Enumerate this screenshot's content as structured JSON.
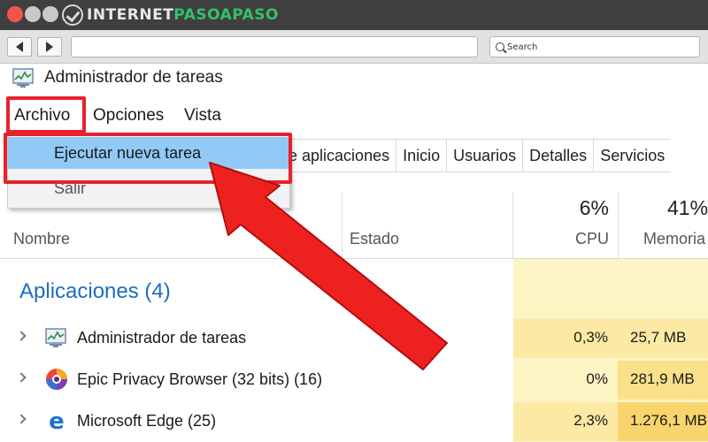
{
  "browser": {
    "brand_name": "INTERNETPASOAPASO",
    "brand_prefix": "INTERNET",
    "brand_accent": "PASOAPASO",
    "search_placeholder": "Search",
    "colors": {
      "titlebar": "#3f3f3f",
      "close_dot": "#f2554f",
      "accent": "#33c06a"
    }
  },
  "app": {
    "title": "Administrador de tareas",
    "icon": "task-manager-icon"
  },
  "menubar": {
    "archivo": "Archivo",
    "opciones": "Opciones",
    "vista": "Vista"
  },
  "file_menu": {
    "run_new_task": "Ejecutar nueva tarea",
    "exit": "Salir",
    "highlight_color": "#91c9f7"
  },
  "tabs": [
    {
      "label": "de aplicaciones"
    },
    {
      "label": "Inicio"
    },
    {
      "label": "Usuarios"
    },
    {
      "label": "Detalles"
    },
    {
      "label": "Servicios"
    }
  ],
  "columns": {
    "name": "Nombre",
    "state": "Estado",
    "cpu_percent": "6%",
    "cpu": "CPU",
    "memory_percent": "41%",
    "memory": "Memoria"
  },
  "section": {
    "title": "Aplicaciones (4)"
  },
  "processes": [
    {
      "name": "Administrador de tareas",
      "icon": "task-manager-icon",
      "cpu": "0,3%",
      "memory": "25,7 MB"
    },
    {
      "name": "Epic Privacy Browser (32 bits) (16)",
      "icon": "epic-browser-icon",
      "cpu": "0%",
      "memory": "281,9 MB"
    },
    {
      "name": "Microsoft Edge (25)",
      "icon": "edge-icon",
      "cpu": "2,3%",
      "memory": "1.276,1 MB"
    }
  ],
  "annotation": {
    "highlight_color": "#e8212e",
    "arrow_icon": "red-pointer-arrow"
  }
}
